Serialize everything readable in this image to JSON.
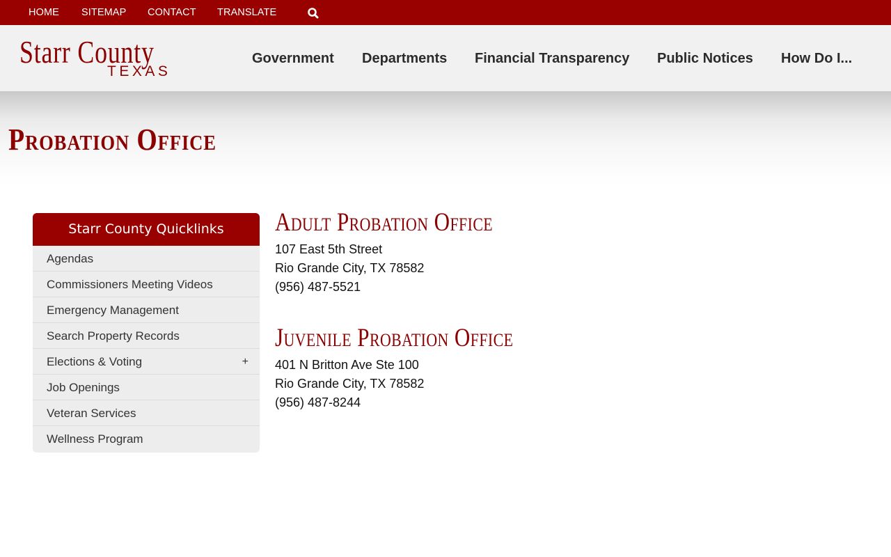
{
  "topbar": {
    "links": [
      "HOME",
      "SITEMAP",
      "CONTACT",
      "TRANSLATE"
    ],
    "search_icon": "search-icon",
    "background": "#990000"
  },
  "header": {
    "logo_line1": "Starr County",
    "logo_line2": "TEXAS",
    "nav": [
      "Government",
      "Departments",
      "Financial Transparency",
      "Public Notices",
      "How Do I..."
    ]
  },
  "page": {
    "title": "Probation Office"
  },
  "sidebar": {
    "title": "Starr County Quicklinks",
    "items": [
      {
        "label": "Agendas"
      },
      {
        "label": "Commissioners Meeting Videos"
      },
      {
        "label": "Emergency Management"
      },
      {
        "label": "Search Property Records"
      },
      {
        "label": "Elections & Voting",
        "expand": "+"
      },
      {
        "label": "Job Openings"
      },
      {
        "label": "Veteran Services"
      },
      {
        "label": "Wellness Program"
      }
    ]
  },
  "offices": [
    {
      "heading": "Adult Probation Office",
      "address1": "107 East 5th Street",
      "address2": "Rio Grande City, TX 78582",
      "phone": "(956) 487-5521"
    },
    {
      "heading": "Juvenile Probation Office",
      "address1": "401 N Britton Ave Ste 100",
      "address2": "Rio Grande City, TX 78582",
      "phone": "(956) 487-8244"
    }
  ],
  "colors": {
    "brand": "#990000",
    "header_bg": "#f1f1f1",
    "sidebar_bg": "#ededed"
  }
}
